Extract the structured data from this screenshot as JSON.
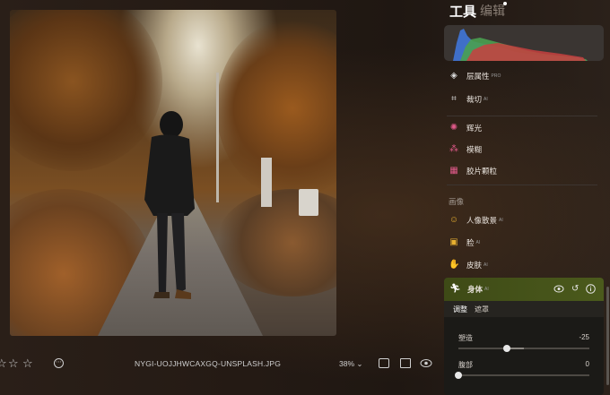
{
  "photo": {
    "description_alt": ""
  },
  "bottombar": {
    "filename": "NYGI-UOJJHWCAXGQ-UNSPLASH.JPG",
    "zoom": "38%",
    "zoom_caret": "⌄"
  },
  "panel": {
    "tab_tools": "工具",
    "tab_edit": "编辑",
    "items": [
      {
        "label": "层属性",
        "badge": "PRO",
        "icon": "layers-icon"
      },
      {
        "label": "裁切",
        "badge": "AI",
        "icon": "crop-icon"
      },
      {
        "label": "辉光",
        "badge": "",
        "icon": "glow-icon"
      },
      {
        "label": "模糊",
        "badge": "",
        "icon": "blur-icon"
      },
      {
        "label": "胶片颗粒",
        "badge": "",
        "icon": "film-grain-icon"
      }
    ],
    "section_portrait": "画像",
    "portrait_items": [
      {
        "label": "人像散景",
        "badge": "AI",
        "icon": "portrait-bokeh-icon"
      },
      {
        "label": "脸",
        "badge": "AI",
        "icon": "face-icon"
      },
      {
        "label": "皮肤",
        "badge": "AI",
        "icon": "skin-icon"
      }
    ],
    "body": {
      "title": "身体",
      "badge": "AI",
      "subtab_adjust": "调整",
      "subtab_mask": "遮罩",
      "sliders": [
        {
          "label": "塑造",
          "value": "-25",
          "fraction": 0.375
        },
        {
          "label": "腹部",
          "value": "0",
          "fraction": 0.0
        }
      ]
    }
  },
  "colors": {
    "accent_body": "#4b5a1c",
    "panel_bg": "#1b1a17"
  }
}
